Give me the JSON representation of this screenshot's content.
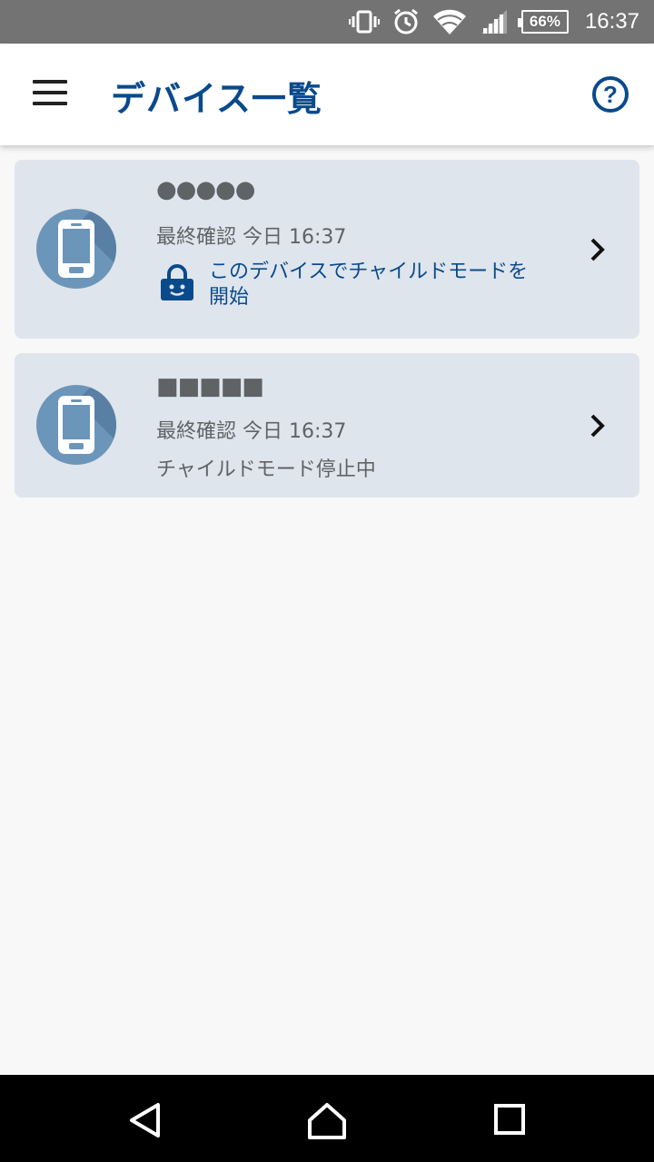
{
  "status_bar": {
    "icons": [
      "vibrate-icon",
      "alarm-icon",
      "wifi-icon",
      "signal-icon"
    ],
    "battery": "66%",
    "time": "16:37"
  },
  "app_bar": {
    "title": "デバイス一覧",
    "menu_icon": "hamburger-menu-icon",
    "help_icon": "help-circle-icon",
    "help_glyph": "?"
  },
  "devices": [
    {
      "name": "●●●●●",
      "last_seen": "最終確認 今日 16:37",
      "action": "このデバイスでチャイルドモードを開始",
      "action_line1": "このデバイスでチャイルドモードを",
      "action_line2": "開始"
    },
    {
      "name": "■■■■■",
      "last_seen": "最終確認 今日 16:37",
      "status": "チャイルドモード停止中"
    }
  ],
  "colors": {
    "accent": "#0a4a8c",
    "card_bg": "#dfe5ec",
    "avatar_bg": "#6c95ba",
    "status_bar": "#737373"
  },
  "nav_bar": {
    "icons": [
      "back-icon",
      "home-icon",
      "recent-apps-icon"
    ]
  }
}
